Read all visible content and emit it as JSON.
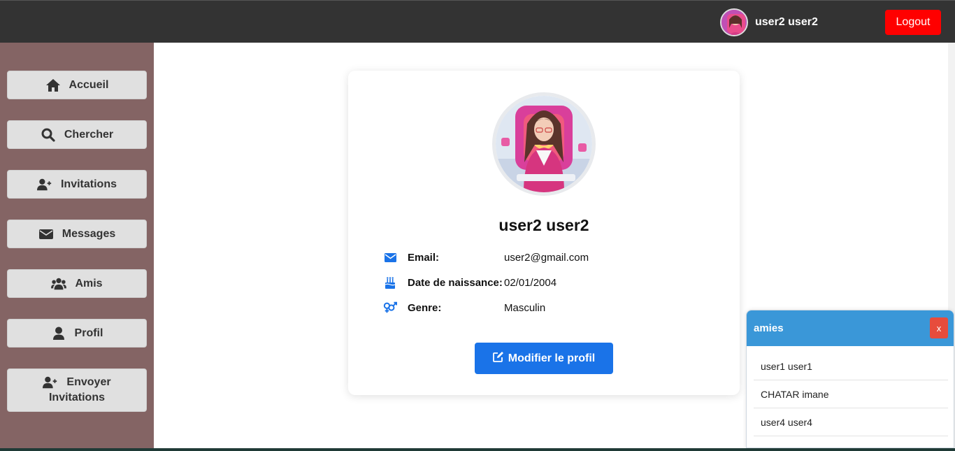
{
  "header": {
    "username": "user2 user2",
    "logout_label": "Logout"
  },
  "sidebar": {
    "items": [
      {
        "label": "Accueil",
        "icon": "home-icon"
      },
      {
        "label": "Chercher",
        "icon": "search-icon"
      },
      {
        "label": "Invitations",
        "icon": "user-plus-icon"
      },
      {
        "label": "Messages",
        "icon": "envelope-icon"
      },
      {
        "label": "Amis",
        "icon": "users-icon"
      },
      {
        "label": "Profil",
        "icon": "user-icon"
      },
      {
        "label_line1": "Envoyer",
        "label_line2": "Invitations",
        "icon": "user-plus-icon"
      }
    ]
  },
  "profile": {
    "name": "user2 user2",
    "fields": [
      {
        "label": "Email:",
        "value": "user2@gmail.com",
        "icon": "envelope-icon"
      },
      {
        "label": "Date de naissance:",
        "value": "02/01/2004",
        "icon": "birthday-cake-icon"
      },
      {
        "label": "Genre:",
        "value": "Masculin",
        "icon": "gender-icon"
      }
    ],
    "edit_label": "Modifier le profil"
  },
  "friends_panel": {
    "title": "amies",
    "close_label": "x",
    "friends": [
      "user1 user1",
      "CHATAR imane",
      "user4 user4"
    ]
  },
  "colors": {
    "topbar": "#333333",
    "sidebar": "#846464",
    "logout": "#ff0000",
    "primary": "#1a73e8",
    "friends_header": "#3a97d8",
    "close": "#e74c3c"
  }
}
